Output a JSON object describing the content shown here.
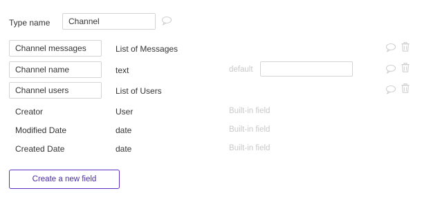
{
  "type_name": {
    "label": "Type name",
    "value": "Channel"
  },
  "custom_fields": [
    {
      "name": "Channel messages",
      "type": "List of Messages",
      "default_label": "",
      "default_value": null
    },
    {
      "name": "Channel name",
      "type": "text",
      "default_label": "default",
      "default_value": ""
    },
    {
      "name": "Channel users",
      "type": "List of Users",
      "default_label": "",
      "default_value": null
    }
  ],
  "builtin_fields": [
    {
      "name": "Creator",
      "type": "User",
      "note": "Built-in field"
    },
    {
      "name": "Modified Date",
      "type": "date",
      "note": "Built-in field"
    },
    {
      "name": "Created Date",
      "type": "date",
      "note": "Built-in field"
    }
  ],
  "create_button_label": "Create a new field",
  "colors": {
    "accent": "#5a2bc4",
    "muted_text": "#c9c9c9",
    "border": "#d4d4d4",
    "icon": "#cfcfcf"
  }
}
